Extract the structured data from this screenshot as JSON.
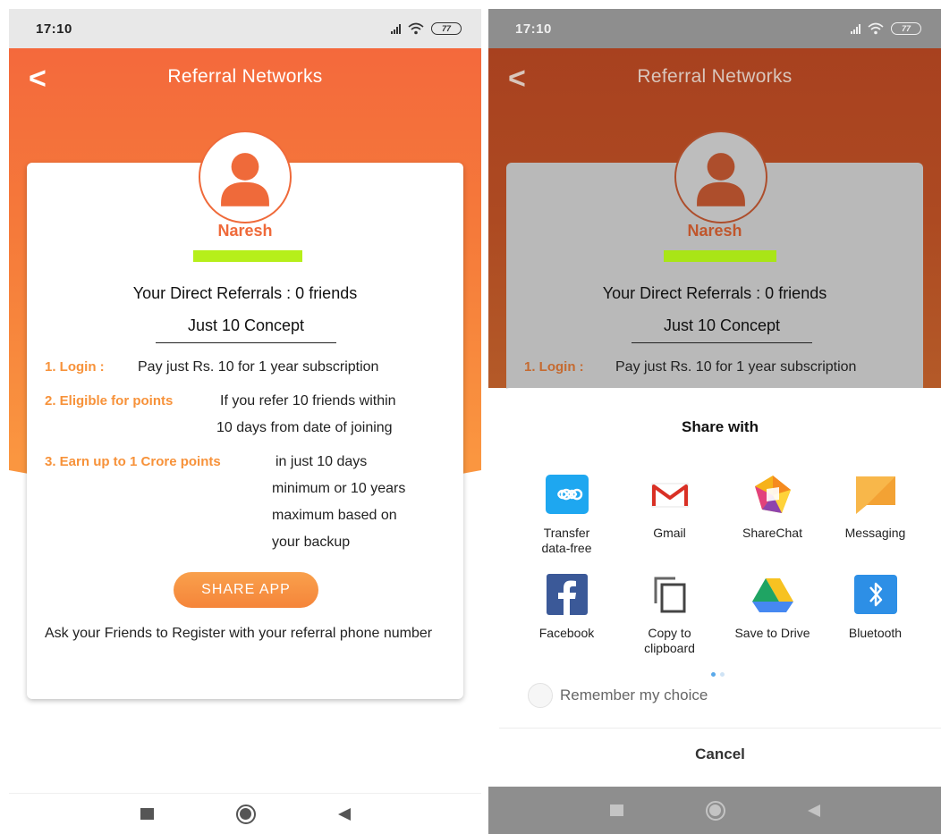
{
  "status_bar": {
    "time": "17:10",
    "battery": "77"
  },
  "header": {
    "title": "Referral Networks",
    "back_glyph": "<"
  },
  "profile": {
    "name": "Naresh",
    "icon": "user-icon"
  },
  "referrals": {
    "text": "Your Direct Referrals :  0  friends"
  },
  "concept": {
    "title": "Just 10 Concept"
  },
  "rules": [
    {
      "label": "1. Login :",
      "text": "Pay just Rs. 10 for 1 year subscription"
    },
    {
      "label": "2. Eligible for points",
      "text_line1": "If you refer 10 friends within",
      "text_line2": "10 days from date of joining"
    },
    {
      "label": "3. Earn up to 1 Crore points",
      "text_line1": "in just 10 days",
      "text_line2": "minimum or 10 years",
      "text_line3": "maximum based on",
      "text_line4": "your backup"
    }
  ],
  "share_button": {
    "label": "SHARE APP"
  },
  "ask_text": "Ask your Friends to Register with your referral phone number",
  "share_sheet": {
    "title": "Share with",
    "apps": [
      {
        "label_line1": "Transfer",
        "label_line2": "data-free",
        "icon": "transfer-icon",
        "color": "#1ea7f0"
      },
      {
        "label_line1": "Gmail",
        "label_line2": "",
        "icon": "gmail-icon",
        "color": "#d93025"
      },
      {
        "label_line1": "ShareChat",
        "label_line2": "",
        "icon": "sharechat-icon",
        "color": "#f6b21b"
      },
      {
        "label_line1": "Messaging",
        "label_line2": "",
        "icon": "messaging-icon",
        "color": "#f8b74a"
      },
      {
        "label_line1": "Facebook",
        "label_line2": "",
        "icon": "facebook-icon",
        "color": "#3b5998"
      },
      {
        "label_line1": "Copy to",
        "label_line2": "clipboard",
        "icon": "copy-icon",
        "color": "#555555"
      },
      {
        "label_line1": "Save to Drive",
        "label_line2": "",
        "icon": "drive-icon",
        "color": "#1fa463"
      },
      {
        "label_line1": "Bluetooth",
        "label_line2": "",
        "icon": "bluetooth-icon",
        "color": "#2d8fe6"
      }
    ],
    "remember": "Remember my choice",
    "cancel": "Cancel"
  },
  "colors": {
    "accent": "#f4693c",
    "label_orange": "#f7923a",
    "highlight": "#b6ef1a"
  }
}
